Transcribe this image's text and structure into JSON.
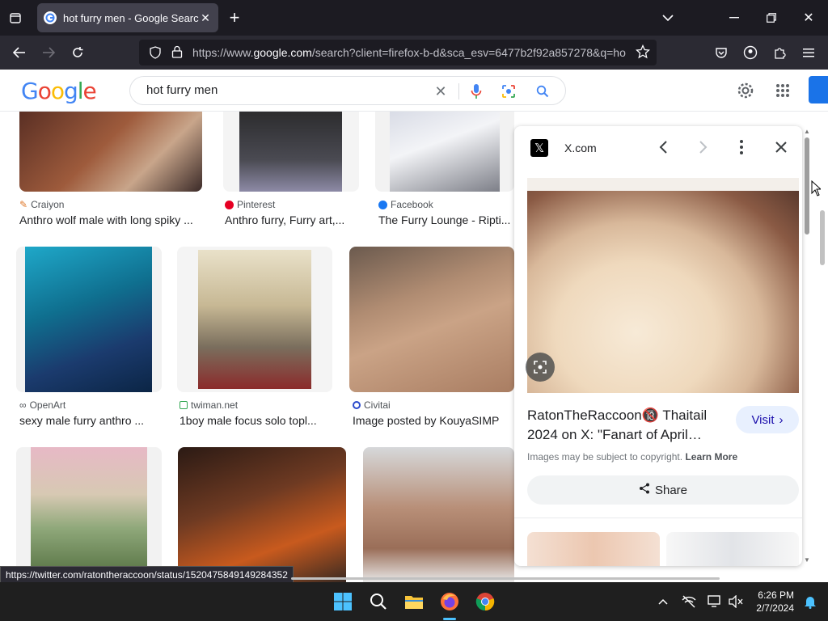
{
  "browser": {
    "tab_title": "hot furry men - Google Search",
    "url_prefix": "https://www.",
    "url_domain": "google.com",
    "url_rest": "/search?client=firefox-b-d&sca_esv=6477b2f92a857278&q=ho"
  },
  "google": {
    "logo_letters": [
      "G",
      "o",
      "o",
      "g",
      "l",
      "e"
    ],
    "logo_colors": [
      "#4285f4",
      "#ea4335",
      "#fbbc05",
      "#4285f4",
      "#34a853",
      "#ea4335"
    ],
    "search_value": "hot furry men"
  },
  "results": {
    "row1": [
      {
        "source": "Craiyon",
        "caption": "Anthro wolf male with long spiky ..."
      },
      {
        "source": "Pinterest",
        "caption": "Anthro furry, Furry art,..."
      },
      {
        "source": "Facebook",
        "caption": "The Furry Lounge - Ripti..."
      }
    ],
    "row2": [
      {
        "source": "OpenArt",
        "caption": "sexy male furry anthro ..."
      },
      {
        "source": "twiman.net",
        "caption": "1boy male focus solo topl..."
      },
      {
        "source": "Civitai",
        "caption": "Image posted by KouyaSIMP"
      }
    ]
  },
  "panel": {
    "site": "X.com",
    "title": "RatonTheRaccoon🔞 Thaitail 2024 on X: \"Fanart of April…",
    "visit_label": "Visit",
    "copyright_text": "Images may be subject to copyright.",
    "learn_more": "Learn More",
    "share_label": "Share"
  },
  "status_url": "https://twitter.com/ratontheraccoon/status/1520475849149284352",
  "taskbar": {
    "time": "6:26 PM",
    "date": "2/7/2024"
  },
  "colors": {
    "chrome_dark": "#1c1b22",
    "tab_active": "#42414d",
    "google_blue": "#1a73e8"
  }
}
